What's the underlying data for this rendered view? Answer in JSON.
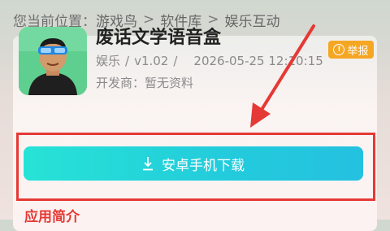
{
  "breadcrumb": {
    "prefix": "您当前位置：",
    "items": [
      "游戏鸟",
      "软件库",
      "娱乐互动"
    ],
    "separator": ">"
  },
  "report_label": "举报",
  "app": {
    "name": "废话文学语音盒",
    "category": "娱乐",
    "version": "v1.02",
    "updated": "2026-05-25 12:10:15",
    "developer_label": "开发商：",
    "developer": "暂无资料"
  },
  "download_label": "安卓手机下载",
  "intro_heading": "应用简介",
  "colors": {
    "accent": "#e53935",
    "button_start": "#27e3d6",
    "button_end": "#24c1e0",
    "report": "#f5a623"
  },
  "icons": [
    "warning-icon",
    "download-icon",
    "app-icon"
  ]
}
